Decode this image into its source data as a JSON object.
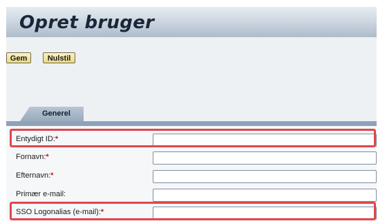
{
  "header": {
    "title": "Opret bruger"
  },
  "toolbar": {
    "save_label": "Gem",
    "reset_label": "Nulstil"
  },
  "tabs": [
    {
      "label": "Generel"
    }
  ],
  "form": {
    "fields": [
      {
        "label": "Entydigt ID:",
        "required_mark": "*",
        "value": ""
      },
      {
        "label": "Fornavn:",
        "required_mark": "*",
        "value": ""
      },
      {
        "label": "Efternavn:",
        "required_mark": "*",
        "value": ""
      },
      {
        "label": "Primær e-mail:",
        "required_mark": "",
        "value": ""
      },
      {
        "label": "SSO Logonalias (e-mail):",
        "required_mark": "*",
        "value": ""
      }
    ]
  },
  "colors": {
    "highlight": "#e0464c",
    "required": "#c81818",
    "button_fill": "#ebd886",
    "tab_fill": "#98aabb"
  }
}
